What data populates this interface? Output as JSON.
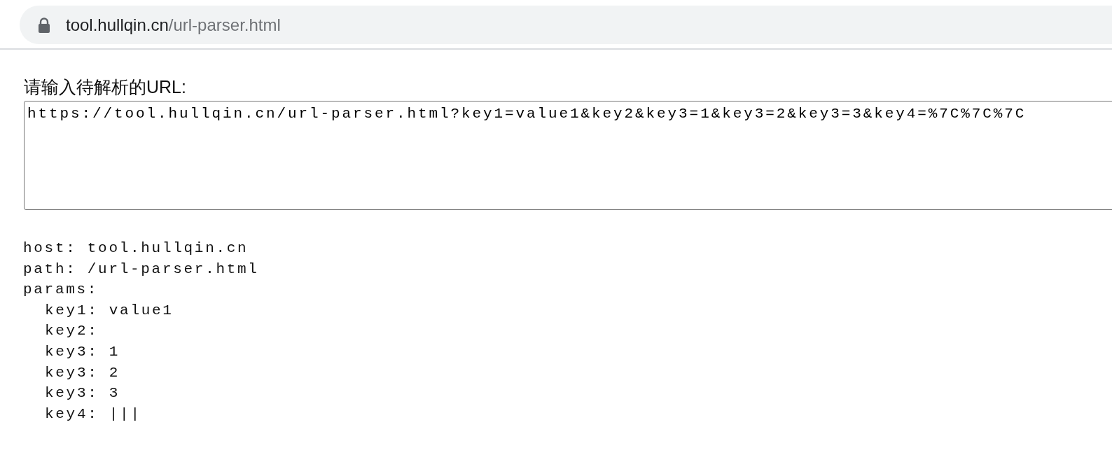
{
  "address_bar": {
    "host": "tool.hullqin.cn",
    "path": "/url-parser.html"
  },
  "form": {
    "label": "请输入待解析的URL:",
    "value": "https://tool.hullqin.cn/url-parser.html?key1=value1&key2&key3=1&key3=2&key3=3&key4=%7C%7C%7C"
  },
  "output": {
    "lines": [
      {
        "text": "host: tool.hullqin.cn"
      },
      {
        "text": "path: /url-parser.html"
      },
      {
        "text": "params:",
        "children": [
          {
            "text": "key1: value1"
          },
          {
            "text": "key2:"
          },
          {
            "text": "key3: 1"
          },
          {
            "text": "key3: 2"
          },
          {
            "text": "key3: 3"
          },
          {
            "text": "key4: |||"
          }
        ]
      }
    ]
  }
}
